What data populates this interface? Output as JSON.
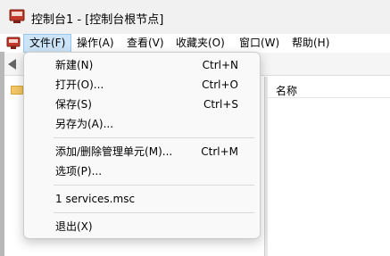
{
  "window": {
    "title": "控制台1 - [控制台根节点]",
    "app_icon": "mmc-console-icon"
  },
  "menubar": {
    "items": [
      {
        "label": "文件(F)",
        "active": true
      },
      {
        "label": "操作(A)"
      },
      {
        "label": "查看(V)"
      },
      {
        "label": "收藏夹(O)"
      },
      {
        "label": "窗口(W)"
      },
      {
        "label": "帮助(H)"
      }
    ]
  },
  "list": {
    "column_header": "名称"
  },
  "file_menu": {
    "items": [
      {
        "label": "新建(N)",
        "shortcut": "Ctrl+N"
      },
      {
        "label": "打开(O)...",
        "shortcut": "Ctrl+O"
      },
      {
        "label": "保存(S)",
        "shortcut": "Ctrl+S"
      },
      {
        "label": "另存为(A)...",
        "shortcut": ""
      },
      {
        "label": "添加/删除管理单元(M)...",
        "shortcut": "Ctrl+M"
      },
      {
        "label": "选项(P)...",
        "shortcut": ""
      },
      {
        "label": "1 services.msc",
        "shortcut": ""
      },
      {
        "label": "退出(X)",
        "shortcut": ""
      }
    ]
  },
  "colors": {
    "menu_highlight": "#cce4f7",
    "folder": "#f4c766"
  }
}
